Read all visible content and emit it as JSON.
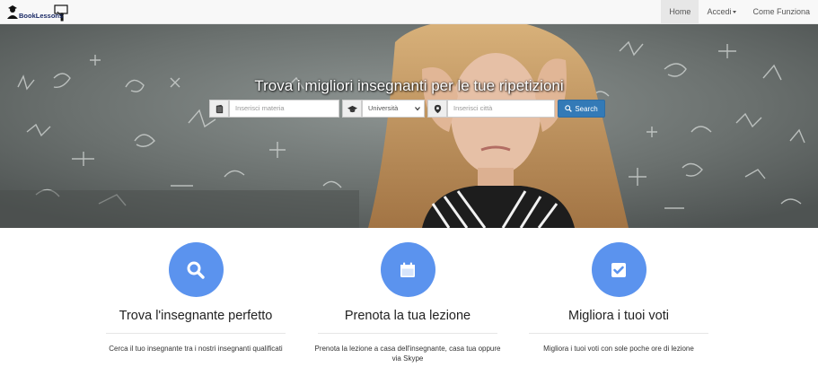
{
  "navbar": {
    "brand": "BookLessons",
    "items": [
      {
        "label": "Home",
        "active": true
      },
      {
        "label": "Accedi",
        "dropdown": true
      },
      {
        "label": "Come Funziona"
      }
    ]
  },
  "hero": {
    "title": "Trova i migliori insegnanti per le tue ripetizioni",
    "search": {
      "subject_placeholder": "Inserisci materia",
      "level_selected": "Università",
      "city_placeholder": "Inserisci città",
      "button_label": "Search"
    }
  },
  "features": [
    {
      "icon": "search-icon",
      "title": "Trova l'insegnante perfetto",
      "text": "Cerca il tuo insegnante tra i nostri insegnanti qualificati"
    },
    {
      "icon": "calendar-icon",
      "title": "Prenota la tua lezione",
      "text": "Prenota la lezione a casa dell'insegnante, casa tua oppure via Skype"
    },
    {
      "icon": "checkbox-icon",
      "title": "Migliora i tuoi voti",
      "text": "Migliora i tuoi voti con sole poche ore di lezione"
    }
  ],
  "colors": {
    "accent": "#5b93ee",
    "button": "#337ab7",
    "navbar_bg": "#f8f8f8"
  }
}
